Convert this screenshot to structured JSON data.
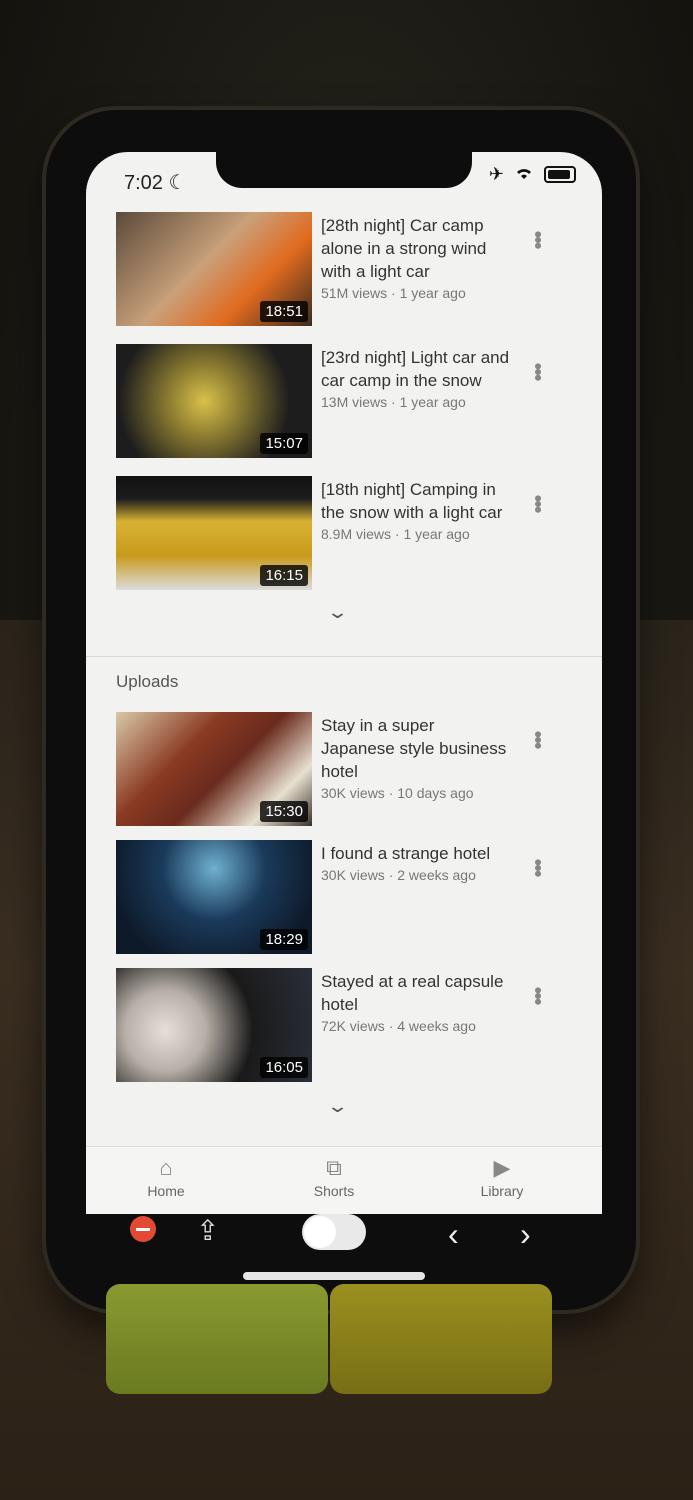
{
  "status": {
    "time": "7:02"
  },
  "videos_top": [
    {
      "title": "[28th night] Car camp alone in a strong wind with a light car",
      "sub": "51M views · 1 year ago",
      "duration": "18:51"
    },
    {
      "title": "[23rd night] Light car and car camp in the snow",
      "sub": "13M views · 1 year ago",
      "duration": "15:07"
    },
    {
      "title": "[18th night] Camping in the snow with a light car",
      "sub": "8.9M views · 1 year ago",
      "duration": "16:15"
    }
  ],
  "uploads": {
    "heading": "Uploads",
    "videos": [
      {
        "title": "Stay in a super Japanese style business hotel",
        "sub": "30K views · 10 days ago",
        "duration": "15:30"
      },
      {
        "title": "I found a strange hotel",
        "sub": "30K views · 2 weeks ago",
        "duration": "18:29"
      },
      {
        "title": "Stayed at a real capsule hotel",
        "sub": "72K views · 4 weeks ago",
        "duration": "16:05"
      }
    ]
  },
  "tabs": {
    "home": "Home",
    "shorts": "Shorts",
    "library": "Library"
  },
  "icons": {
    "moon": "☾",
    "airplane": "✈",
    "chevron": "⌄",
    "more": "•••",
    "home": "⌂",
    "shorts": "⧉",
    "library": "▶",
    "share": "⇪",
    "back": "‹",
    "forward": "›"
  }
}
